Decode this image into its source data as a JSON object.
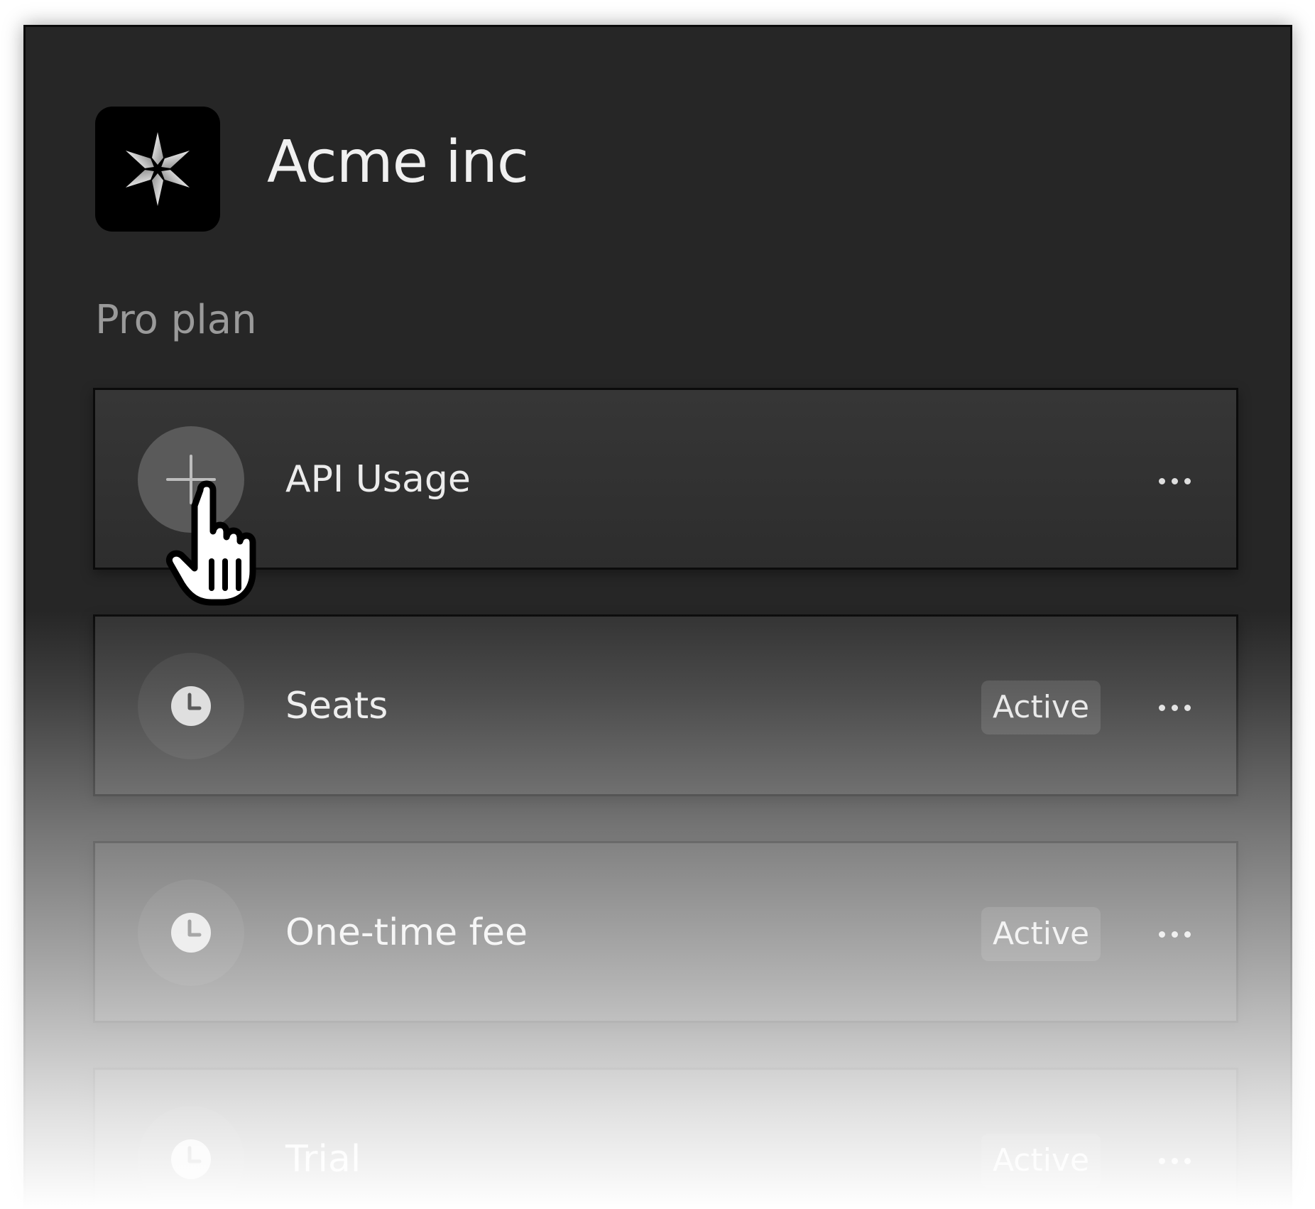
{
  "header": {
    "logo_icon": "six-point-star-icon",
    "company_name": "Acme inc"
  },
  "plan": {
    "name": "Pro plan"
  },
  "items": [
    {
      "label": "API Usage",
      "icon": "plus-icon",
      "badge": null
    },
    {
      "label": "Seats",
      "icon": "clock-icon",
      "badge": "Active"
    },
    {
      "label": "One-time fee",
      "icon": "clock-icon",
      "badge": "Active"
    },
    {
      "label": "Trial",
      "icon": "clock-icon",
      "badge": "Active"
    }
  ],
  "more_icon": "ellipsis-icon",
  "cursor_icon": "pointer-hand-icon",
  "colors": {
    "panel_background": "#262626",
    "card_background": "#333333",
    "badge_background": "#4a4a4a",
    "text_primary": "#ececec",
    "text_muted": "#9a9a9a"
  }
}
